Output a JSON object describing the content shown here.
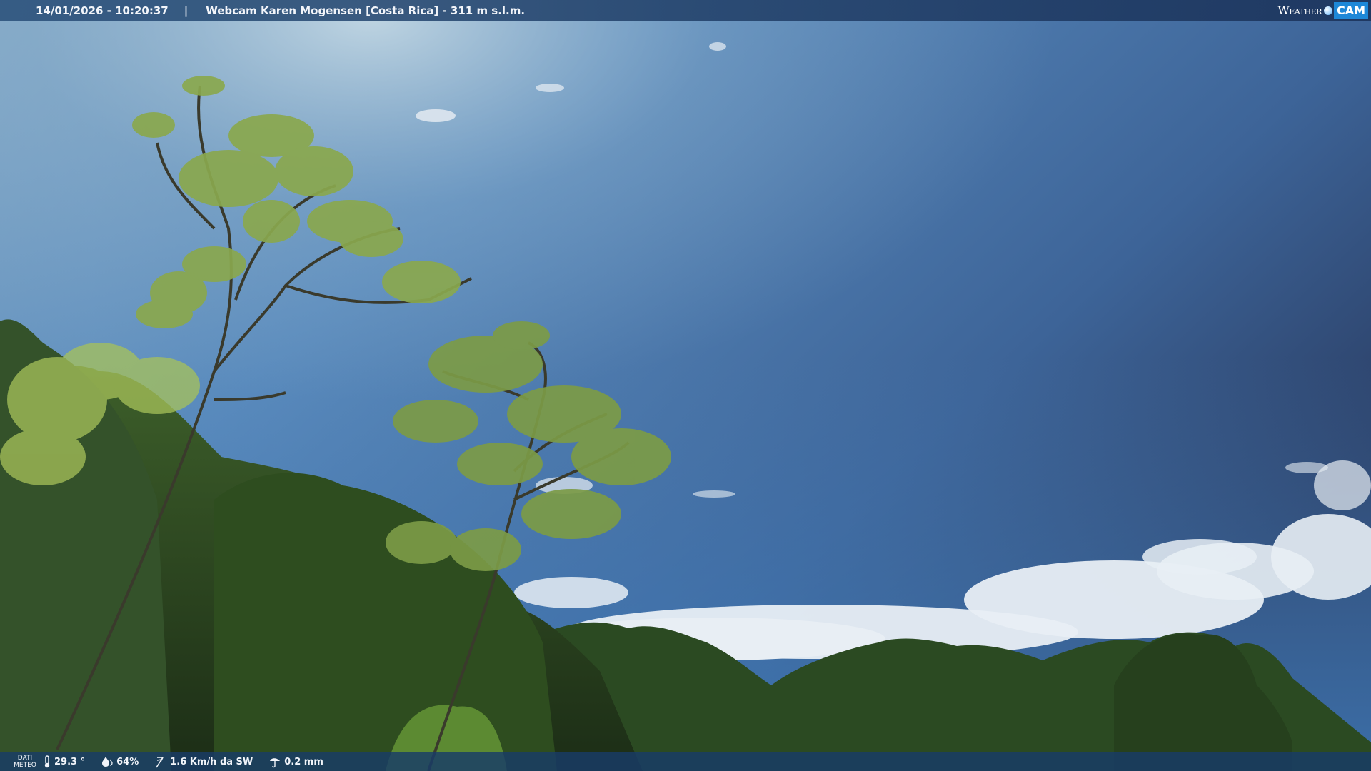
{
  "overlay": {
    "datetime": "14/01/2026 - 10:20:37",
    "separator": "|",
    "title": "Webcam Karen Mogensen [Costa Rica] - 311 m s.l.m."
  },
  "logo": {
    "weather": "Weather",
    "cam": "CAM"
  },
  "weather_data": {
    "label_line1": "DATI",
    "label_line2": "METEO",
    "temperature": "29.3 °",
    "humidity": "64%",
    "wind": "1.6 Km/h da SW",
    "rain": "0.2 mm"
  },
  "icons": [
    "thermometer-icon",
    "humidity-icon",
    "wind-icon",
    "rain-icon"
  ]
}
